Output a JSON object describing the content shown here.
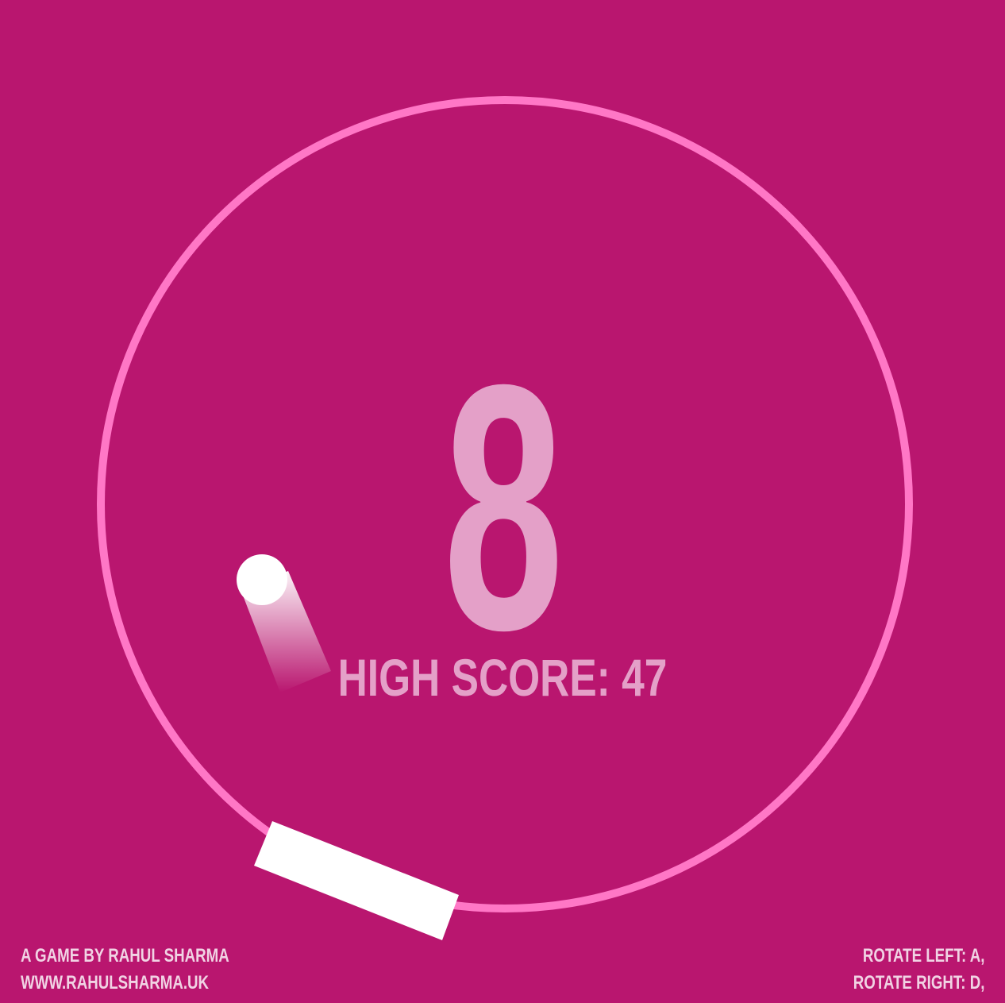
{
  "game": {
    "score": "8",
    "high_score_label": "HIGH SCORE: 47",
    "colors": {
      "background": "#b9166f",
      "ring": "#ff77c6",
      "score_text": "#e4a0c8",
      "paddle": "#ffffff",
      "ball": "#ffffff"
    }
  },
  "footer": {
    "credit_line1": "A GAME BY RAHUL SHARMA",
    "credit_line2": "WWW.RAHULSHARMA.UK",
    "controls_line1": "ROTATE LEFT: A,",
    "controls_line2": "ROTATE RIGHT: D,"
  }
}
